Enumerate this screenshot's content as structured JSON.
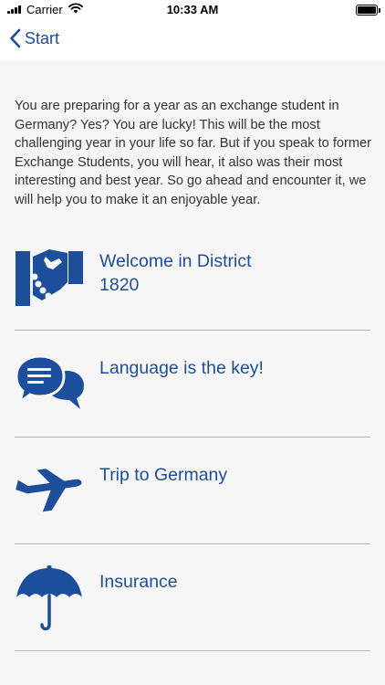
{
  "status_bar": {
    "carrier": "Carrier",
    "time": "10:33 AM"
  },
  "nav": {
    "back_label": "Start"
  },
  "intro_text": "You are preparing for a year as an exchange student in Germany? Yes? You are lucky! This will be the most challenging year in your life so far. But if you speak to former Exchange Students, you will hear, it also was their most interesting and best year. So go ahead and encounter it, we will help you to make it an enjoyable year.",
  "menu": [
    {
      "label": "Welcome in District 1820",
      "icon": "handshake-icon"
    },
    {
      "label": "Language is the key!",
      "icon": "speech-bubbles-icon"
    },
    {
      "label": "Trip to Germany",
      "icon": "airplane-icon"
    },
    {
      "label": "Insurance",
      "icon": "umbrella-icon"
    }
  ],
  "colors": {
    "accent": "#1c4e9b",
    "background": "#f6f6f6",
    "bar_background": "#ffffff",
    "separator": "#b5b5b5",
    "text": "#333333"
  }
}
